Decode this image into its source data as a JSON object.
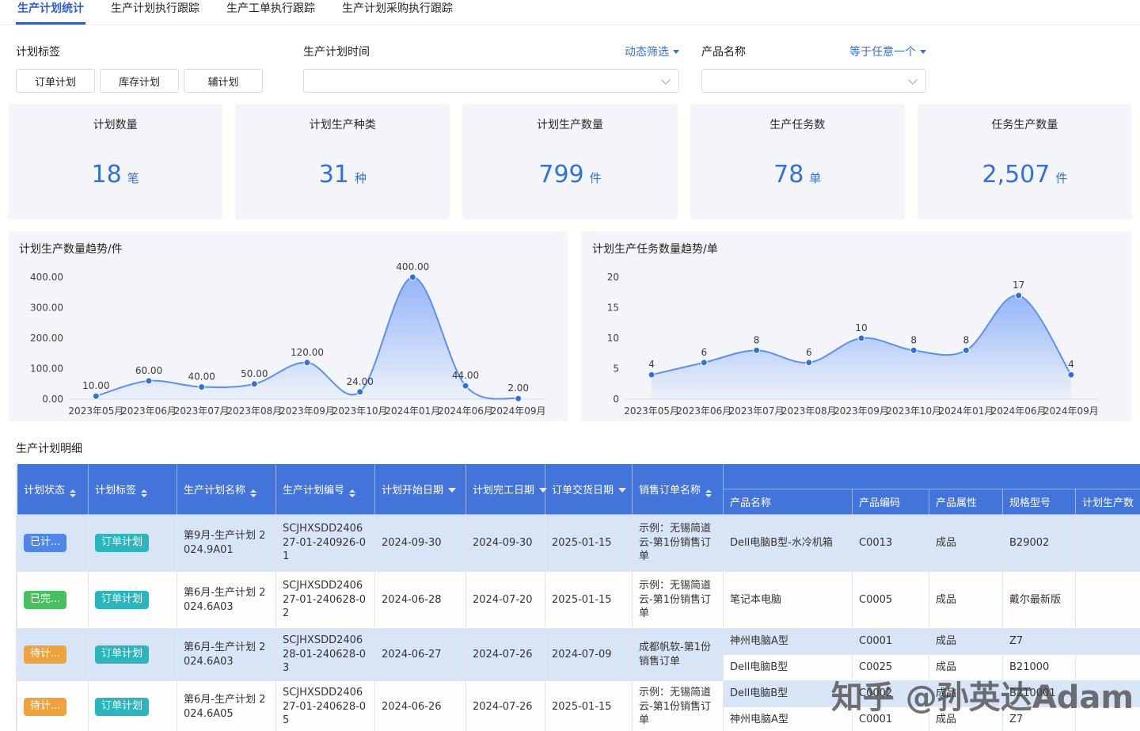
{
  "colors": {
    "accent": "#3370de",
    "tab_active": "#2b5cd9",
    "header_blue": "#4374d9",
    "stripe_blue": "#d8e5f7",
    "tag_teal": "#2bb6bd",
    "status_blue": "#4f86ea",
    "status_green": "#47c15f",
    "status_orange": "#f0a33a",
    "chart_line": "#5b8ff9",
    "chart_point": "#3370de",
    "stat_value": "#3370de"
  },
  "tabs": [
    {
      "label": "生产计划统计",
      "active": true
    },
    {
      "label": "生产计划执行跟踪",
      "active": false
    },
    {
      "label": "生产工单执行跟踪",
      "active": false
    },
    {
      "label": "生产计划采购执行跟踪",
      "active": false
    }
  ],
  "filters": {
    "plan_tag_label": "计划标签",
    "plan_tag_buttons": [
      "订单计划",
      "库存计划",
      "辅计划"
    ],
    "time_label": "生产计划时间",
    "time_mode": "动态筛选",
    "time_value": "",
    "product_label": "产品名称",
    "product_mode": "等于任意一个",
    "product_value": ""
  },
  "stat_cards": [
    {
      "title": "计划数量",
      "value": "18",
      "unit": "笔"
    },
    {
      "title": "计划生产种类",
      "value": "31",
      "unit": "种"
    },
    {
      "title": "计划生产数量",
      "value": "799",
      "unit": "件"
    },
    {
      "title": "生产任务数",
      "value": "78",
      "unit": "单"
    },
    {
      "title": "任务生产数量",
      "value": "2,507",
      "unit": "件"
    }
  ],
  "chart_data": [
    {
      "type": "area",
      "title": "计划生产数量趋势/件",
      "categories": [
        "2023年05月",
        "2023年06月",
        "2023年07月",
        "2023年08月",
        "2023年09月",
        "2023年10月",
        "2024年01月",
        "2024年06月",
        "2024年09月"
      ],
      "values": [
        10,
        60,
        40,
        50,
        120,
        24,
        400,
        44,
        2
      ],
      "point_labels": [
        "10.00",
        "60.00",
        "40.00",
        "50.00",
        "120.00",
        "24.00",
        "400.00",
        "44.00",
        "2.00"
      ],
      "ylim": [
        0,
        400
      ],
      "yticks": [
        "0.00",
        "100.00",
        "200.00",
        "300.00",
        "400.00"
      ],
      "grid": false,
      "legend": false
    },
    {
      "type": "area",
      "title": "计划生产任务数量趋势/单",
      "categories": [
        "2023年05月",
        "2023年06月",
        "2023年07月",
        "2023年08月",
        "2023年09月",
        "2023年10月",
        "2024年01月",
        "2024年06月",
        "2024年09月"
      ],
      "values": [
        4,
        6,
        8,
        6,
        10,
        8,
        8,
        17,
        4
      ],
      "point_labels": [
        "4",
        "6",
        "8",
        "6",
        "10",
        "8",
        "8",
        "17",
        "4"
      ],
      "ylim": [
        0,
        20
      ],
      "yticks": [
        "0",
        "5",
        "10",
        "15",
        "20"
      ],
      "grid": false,
      "legend": false
    }
  ],
  "table": {
    "title": "生产计划明细",
    "columns": [
      {
        "label": "计划状态",
        "sort": "updown",
        "group": "main"
      },
      {
        "label": "计划标签",
        "sort": "updown",
        "group": "main"
      },
      {
        "label": "生产计划名称",
        "sort": "updown",
        "group": "main"
      },
      {
        "label": "生产计划编号",
        "sort": "updown",
        "group": "main"
      },
      {
        "label": "计划开始日期",
        "sort": "down",
        "group": "main"
      },
      {
        "label": "计划完工日期",
        "sort": "down",
        "group": "main"
      },
      {
        "label": "订单交货日期",
        "sort": "down",
        "group": "main"
      },
      {
        "label": "销售订单名称",
        "sort": "updown",
        "group": "main"
      },
      {
        "label": "产品名称",
        "sort": "none",
        "group": "product"
      },
      {
        "label": "产品编码",
        "sort": "none",
        "group": "product"
      },
      {
        "label": "产品属性",
        "sort": "none",
        "group": "product"
      },
      {
        "label": "规格型号",
        "sort": "none",
        "group": "product"
      },
      {
        "label": "计划生产数",
        "sort": "none",
        "group": "product"
      }
    ],
    "rows": [
      {
        "status": "已计...",
        "status_color": "blue",
        "tag": "订单计划",
        "name": "第9月-生产计划 2024.9A01",
        "code": "SCJHXSDD240627-01-240926-01",
        "start_date": "2024-09-30",
        "finish_date": "2024-09-30",
        "delivery_date": "2025-01-15",
        "sales_order": "示例：无锡简道云-第1份销售订单",
        "products": [
          {
            "name": "Dell电脑B型-水冷机箱",
            "code": "C0013",
            "attr": "成品",
            "spec": "B29002",
            "qty": ""
          }
        ]
      },
      {
        "status": "已完...",
        "status_color": "green",
        "tag": "订单计划",
        "name": "第6月-生产计划 2024.6A03",
        "code": "SCJHXSDD240627-01-240628-02",
        "start_date": "2024-06-28",
        "finish_date": "2024-07-20",
        "delivery_date": "2025-01-15",
        "sales_order": "示例：无锡简道云-第1份销售订单",
        "products": [
          {
            "name": "笔记本电脑",
            "code": "C0005",
            "attr": "成品",
            "spec": "戴尔最新版",
            "qty": ""
          }
        ]
      },
      {
        "status": "待计...",
        "status_color": "orange",
        "tag": "订单计划",
        "name": "第6月-生产计划 2024.6A03",
        "code": "SCJHXSDD240628-01-240628-03",
        "start_date": "2024-06-27",
        "finish_date": "2024-07-26",
        "delivery_date": "2024-07-09",
        "sales_order": "成都帆软-第1份销售订单",
        "products": [
          {
            "name": "神州电脑A型",
            "code": "C0001",
            "attr": "成品",
            "spec": "Z7",
            "qty": ""
          },
          {
            "name": "Dell电脑B型",
            "code": "C0025",
            "attr": "成品",
            "spec": "B21000",
            "qty": ""
          }
        ]
      },
      {
        "status": "待计...",
        "status_color": "orange",
        "tag": "订单计划",
        "name": "第6月-生产计划 2024.6A05",
        "code": "SCJHXSDD240627-01-240628-05",
        "start_date": "2024-06-26",
        "finish_date": "2024-07-26",
        "delivery_date": "2025-01-15",
        "sales_order": "示例：无锡简道云-第1份销售订单",
        "products": [
          {
            "name": "Dell电脑B型",
            "code": "C0002",
            "attr": "成品",
            "spec": "B210001",
            "qty": ""
          },
          {
            "name": "神州电脑A型",
            "code": "C0001",
            "attr": "成品",
            "spec": "Z7",
            "qty": ""
          }
        ]
      }
    ]
  },
  "watermark": "知乎 @孙英达Adam"
}
